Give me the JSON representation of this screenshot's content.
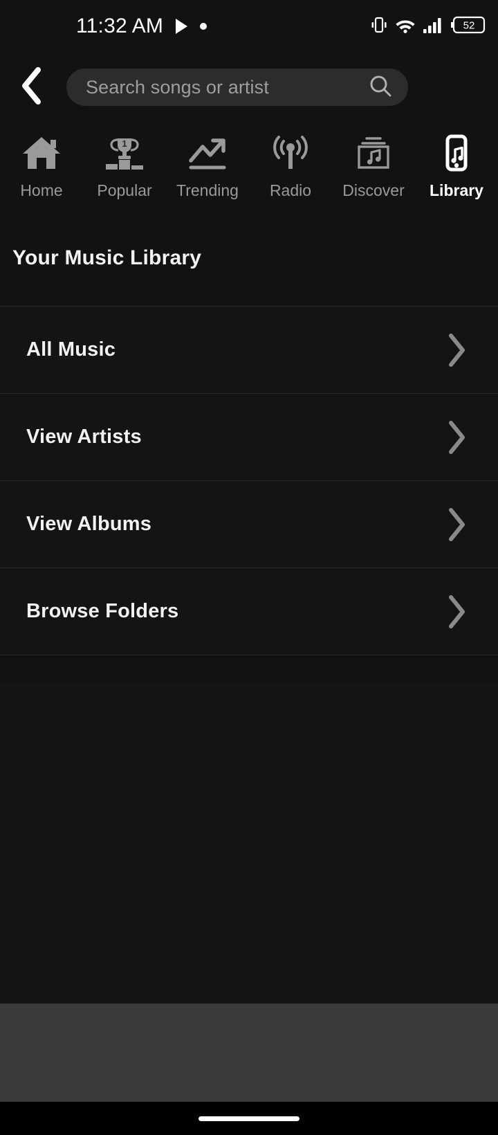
{
  "status_bar": {
    "time": "11:32 AM",
    "icons_left": [
      "play-icon",
      "dot-icon"
    ],
    "icons_right": [
      "vibrate-icon",
      "wifi-icon",
      "cellular-signal-icon",
      "battery-icon"
    ],
    "battery_level": "52"
  },
  "search": {
    "placeholder": "Search songs or artist",
    "value": "",
    "back_icon": "chevron-left-icon",
    "search_icon": "search-icon"
  },
  "nav_tabs": [
    {
      "label": "Home",
      "icon": "home-icon",
      "active": false
    },
    {
      "label": "Popular",
      "icon": "trophy-icon",
      "active": false
    },
    {
      "label": "Trending",
      "icon": "trending-icon",
      "active": false
    },
    {
      "label": "Radio",
      "icon": "radio-icon",
      "active": false
    },
    {
      "label": "Discover",
      "icon": "discover-icon",
      "active": false
    },
    {
      "label": "Library",
      "icon": "library-icon",
      "active": true
    }
  ],
  "section": {
    "title": "Your Music Library"
  },
  "library_items": [
    {
      "label": "All Music",
      "chevron": "chevron-right-icon"
    },
    {
      "label": "View Artists",
      "chevron": "chevron-right-icon"
    },
    {
      "label": "View Albums",
      "chevron": "chevron-right-icon"
    },
    {
      "label": "Browse Folders",
      "chevron": "chevron-right-icon"
    }
  ],
  "colors": {
    "background": "#121212",
    "row_background": "#141414",
    "divider": "#262626",
    "search_field": "#2c2c2c",
    "text_primary": "#f2f2f2",
    "text_secondary": "#9a9a9a",
    "bottom_bar": "#3b3b3b",
    "nav_bar": "#000000"
  }
}
